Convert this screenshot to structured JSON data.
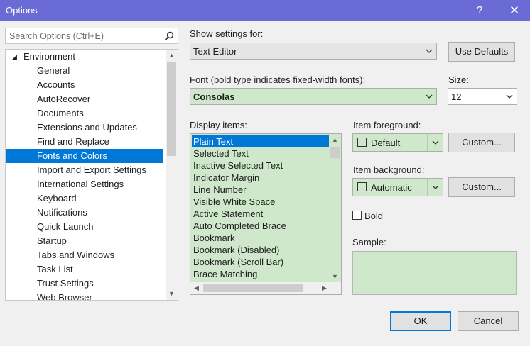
{
  "window": {
    "title": "Options",
    "help_glyph": "?",
    "close_glyph": "✕"
  },
  "search": {
    "placeholder": "Search Options (Ctrl+E)"
  },
  "tree": {
    "root": {
      "label": "Environment",
      "expander": "◢"
    },
    "items": [
      "General",
      "Accounts",
      "AutoRecover",
      "Documents",
      "Extensions and Updates",
      "Find and Replace",
      "Fonts and Colors",
      "Import and Export Settings",
      "International Settings",
      "Keyboard",
      "Notifications",
      "Quick Launch",
      "Startup",
      "Tabs and Windows",
      "Task List",
      "Trust Settings",
      "Web Browser"
    ],
    "selected": "Fonts and Colors"
  },
  "settings": {
    "show_label": "Show settings for:",
    "show_value": "Text Editor",
    "use_defaults": "Use Defaults",
    "font_label": "Font (bold type indicates fixed-width fonts):",
    "font_value": "Consolas",
    "size_label": "Size:",
    "size_value": "12"
  },
  "display_items": {
    "label": "Display items:",
    "items": [
      "Plain Text",
      "Selected Text",
      "Inactive Selected Text",
      "Indicator Margin",
      "Line Number",
      "Visible White Space",
      "Active Statement",
      "Auto Completed Brace",
      "Bookmark",
      "Bookmark (Disabled)",
      "Bookmark (Scroll Bar)",
      "Brace Matching"
    ],
    "selected": "Plain Text"
  },
  "foreground": {
    "label": "Item foreground:",
    "value": "Default",
    "custom": "Custom..."
  },
  "background": {
    "label": "Item background:",
    "value": "Automatic",
    "custom": "Custom..."
  },
  "bold": {
    "label": "Bold",
    "checked": false
  },
  "sample": {
    "label": "Sample:"
  },
  "footer": {
    "ok": "OK",
    "cancel": "Cancel"
  },
  "colors": {
    "title_bar": "#6b6bd6",
    "selection": "#0078d7",
    "sample_bg": "#cfe8cb"
  }
}
